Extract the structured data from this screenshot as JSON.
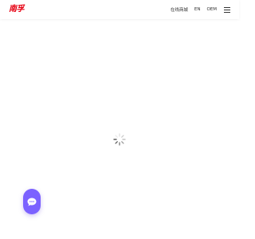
{
  "brand": {
    "logo_text": "南孚",
    "logo_color": "#e60012"
  },
  "nav": {
    "store_label": "在线商城",
    "language_label": "EN",
    "oem_label": "OEM",
    "menu_icon": "hamburger-menu-icon"
  },
  "loading": {
    "icon": "loading-spinner-icon"
  },
  "chat": {
    "icon": "chat-bubble-icon",
    "color": "#7b61ff"
  }
}
